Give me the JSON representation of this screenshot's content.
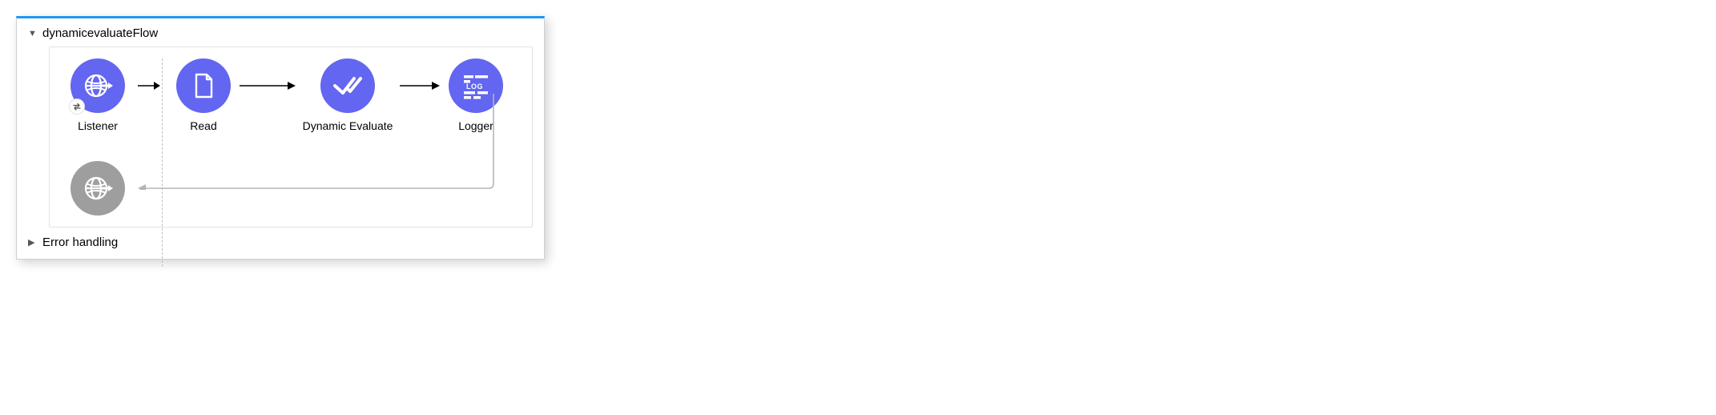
{
  "flow": {
    "title": "dynamicevaluateFlow",
    "errorSection": "Error handling",
    "nodes": {
      "listener": {
        "label": "Listener"
      },
      "read": {
        "label": "Read"
      },
      "evaluate": {
        "label": "Dynamic Evaluate"
      },
      "logger": {
        "label": "Logger"
      }
    },
    "icons": {
      "listener": "globe-arrow-icon",
      "listenerBadge": "exchange-icon",
      "read": "file-icon",
      "evaluate": "double-check-icon",
      "logger": "log-icon",
      "response": "globe-arrow-icon"
    },
    "colors": {
      "nodeActive": "#6366f1",
      "nodeMuted": "#9e9e9e",
      "accentBar": "#2196f3"
    }
  }
}
